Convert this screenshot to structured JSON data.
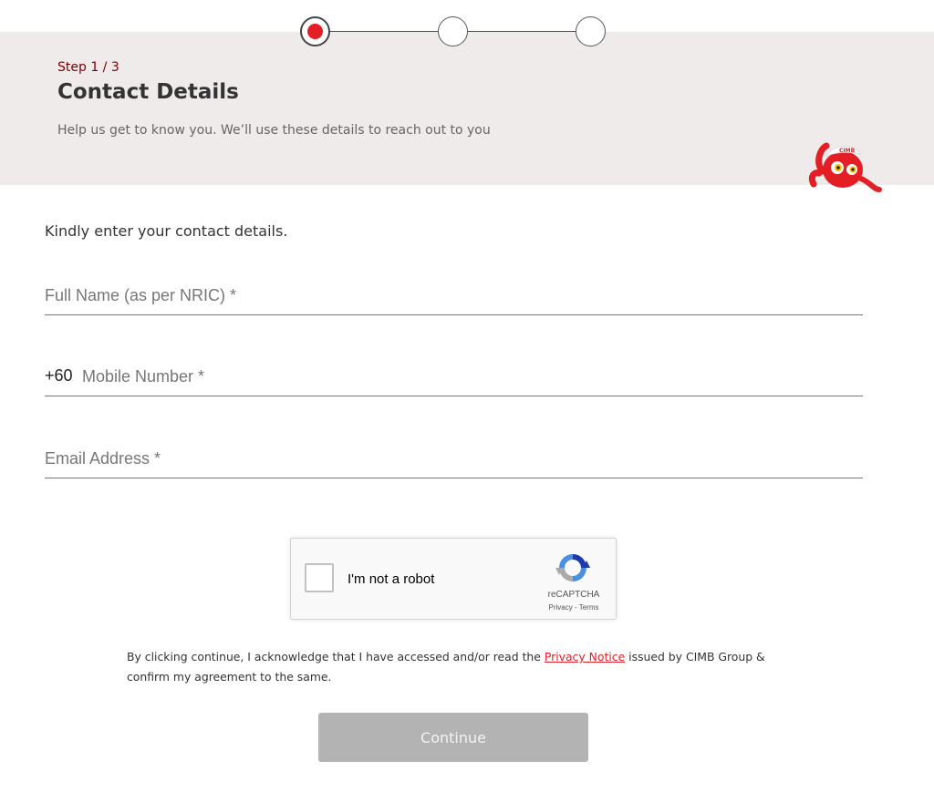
{
  "colors": {
    "accent": "#e31e24",
    "header_bg": "#eeebea",
    "button_disabled": "#b3b3b3",
    "step_label": "#7a0000"
  },
  "stepper": {
    "total_steps": 3,
    "active_step": 1
  },
  "header": {
    "step_label": "Step 1 / 3",
    "title": "Contact Details",
    "subtitle": "Help us get to know you. We’ll use these details to reach out to you"
  },
  "mascot": {
    "icon": "octopus-mascot-icon"
  },
  "form": {
    "intro": "Kindly enter your contact details.",
    "full_name": {
      "placeholder": "Full Name (as per NRIC) *",
      "value": ""
    },
    "mobile": {
      "prefix": "+60",
      "placeholder": "Mobile Number *",
      "value": ""
    },
    "email": {
      "placeholder": "Email Address *",
      "value": ""
    }
  },
  "recaptcha": {
    "label": "I'm not a robot",
    "brand": "reCAPTCHA",
    "privacy": "Privacy",
    "separator": " - ",
    "terms": "Terms",
    "icon": "recaptcha-logo-icon"
  },
  "disclaimer": {
    "before": "By clicking continue, I acknowledge that I have accessed and/or read the ",
    "link": "Privacy Notice",
    "after": " issued by CIMB Group & confirm my agreement to the same."
  },
  "continue_button": {
    "label": "Continue"
  }
}
